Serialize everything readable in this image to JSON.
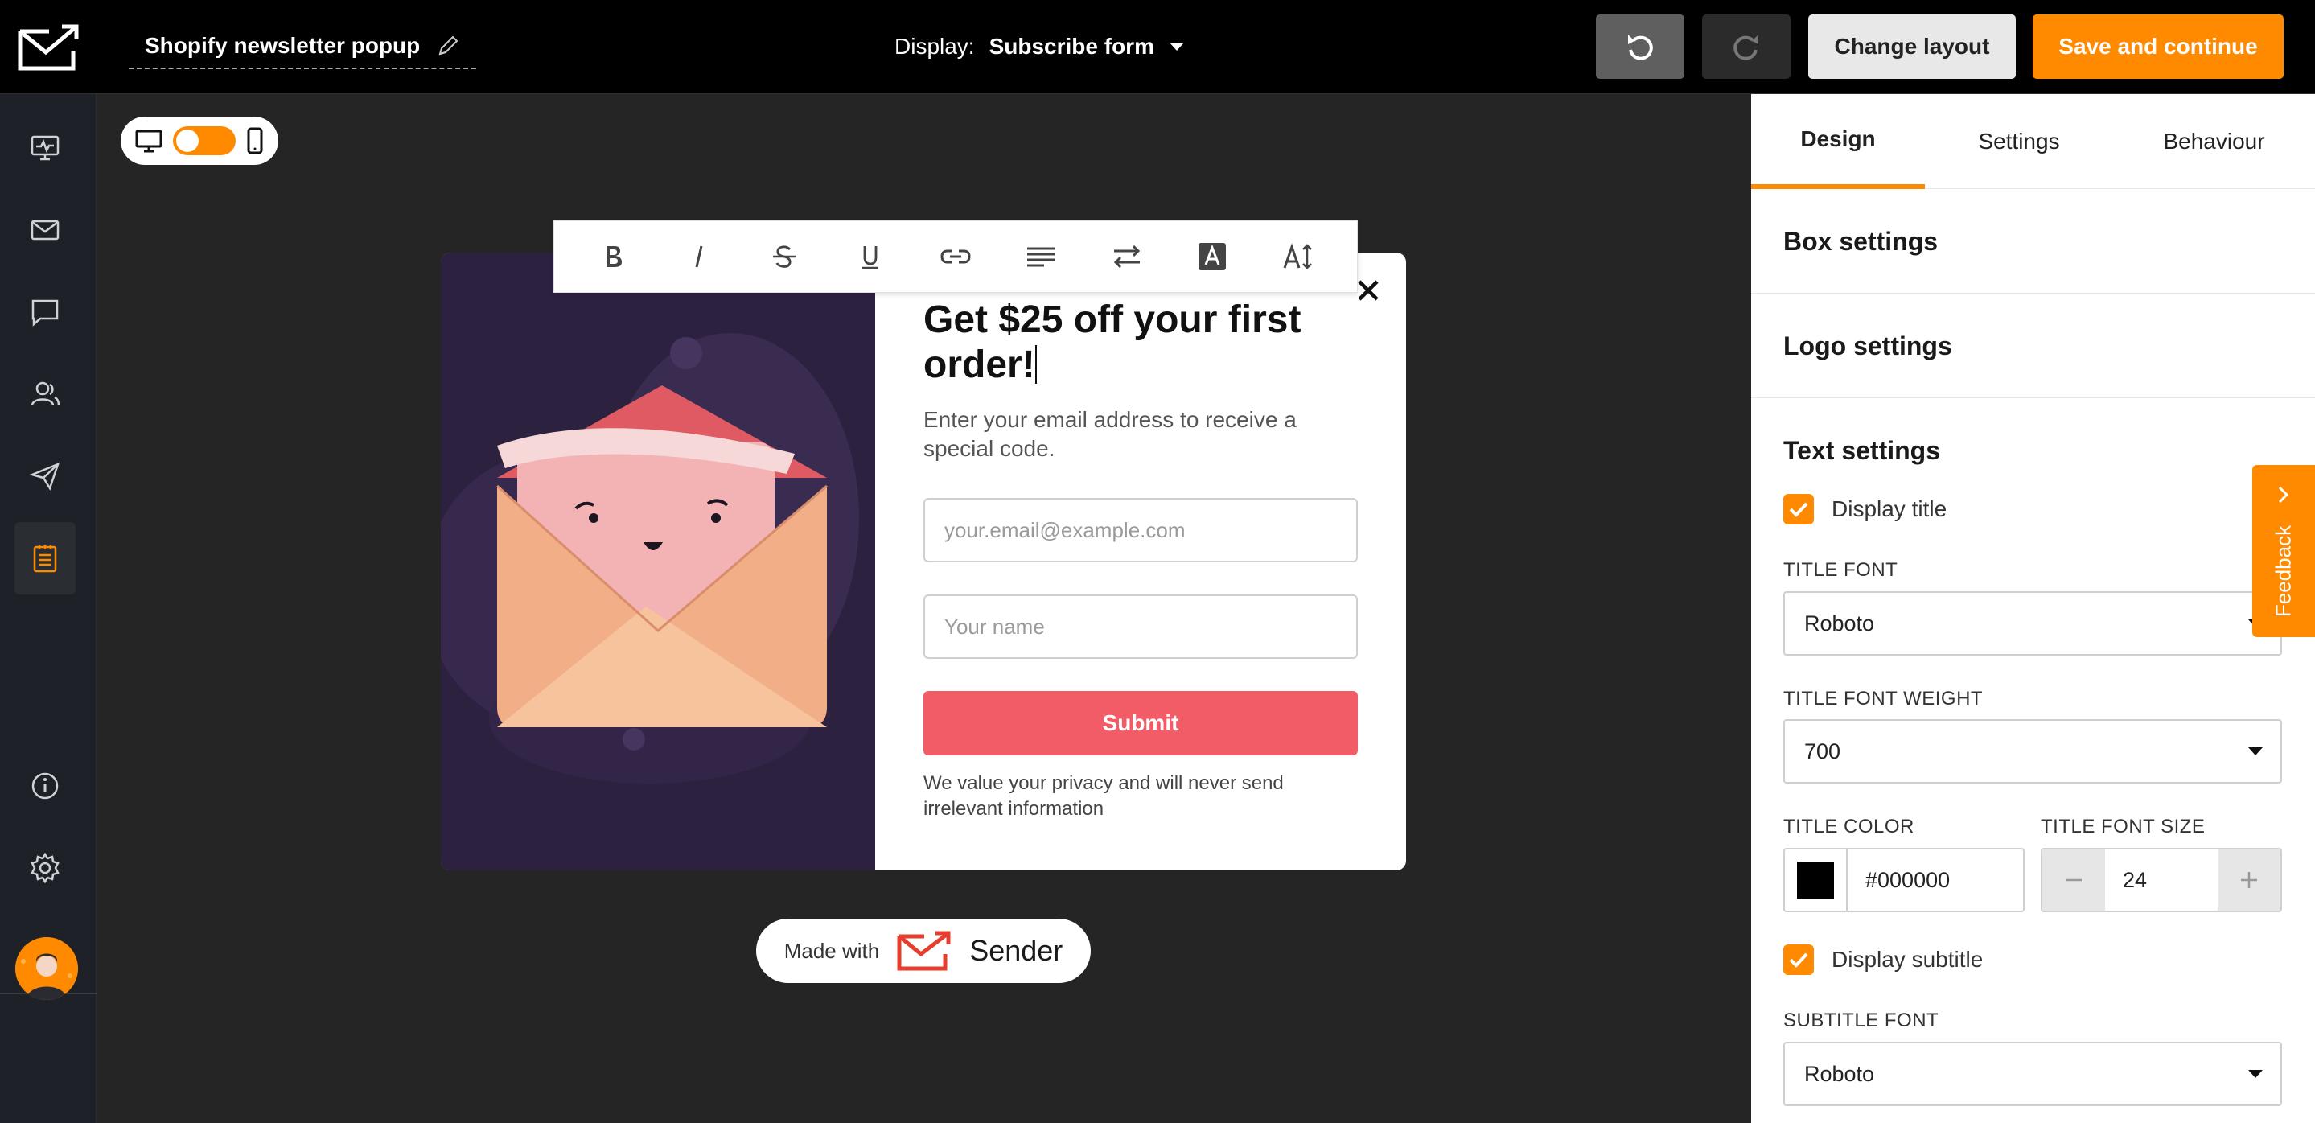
{
  "header": {
    "popup_name": "Shopify newsletter popup",
    "display_label": "Display:",
    "display_value": "Subscribe form",
    "change_layout_label": "Change layout",
    "save_label": "Save and continue"
  },
  "popup": {
    "title": "Get $25 off your first order!",
    "subtitle": "Enter your email address to receive a special code.",
    "email_placeholder": "your.email@example.com",
    "name_placeholder": "Your name",
    "submit_label": "Submit",
    "privacy_text": "We value your privacy and will never send irrelevant information"
  },
  "branding": {
    "made_with": "Made with",
    "brand_name": "Sender"
  },
  "panel": {
    "tabs": [
      {
        "label": "Design",
        "active": true
      },
      {
        "label": "Settings",
        "active": false
      },
      {
        "label": "Behaviour",
        "active": false
      }
    ],
    "box_settings": "Box settings",
    "logo_settings": "Logo settings",
    "text_settings": "Text settings",
    "display_title_label": "Display title",
    "display_title_checked": true,
    "title_font_label": "TITLE FONT",
    "title_font_value": "Roboto",
    "title_font_weight_label": "TITLE FONT WEIGHT",
    "title_font_weight_value": "700",
    "title_color_label": "TITLE COLOR",
    "title_color_value": "#000000",
    "title_font_size_label": "TITLE FONT SIZE",
    "title_font_size_value": "24",
    "display_subtitle_label": "Display subtitle",
    "display_subtitle_checked": true,
    "subtitle_font_label": "SUBTITLE FONT",
    "subtitle_font_value": "Roboto"
  },
  "feedback_label": "Feedback",
  "colors": {
    "accent": "#ff8a00",
    "submit": "#f25c66",
    "topbar": "#000000",
    "canvas": "#252525",
    "sidebar": "#1e2228"
  },
  "icons": {
    "sidebar": [
      "dashboard-icon",
      "mail-icon",
      "chat-icon",
      "subscribers-icon",
      "send-icon",
      "forms-icon",
      "info-icon",
      "gear-icon",
      "power-icon"
    ],
    "toolbar": [
      "bold-icon",
      "italic-icon",
      "strikethrough-icon",
      "underline-icon",
      "link-icon",
      "align-icon",
      "direction-icon",
      "text-color-icon",
      "font-size-icon"
    ]
  }
}
